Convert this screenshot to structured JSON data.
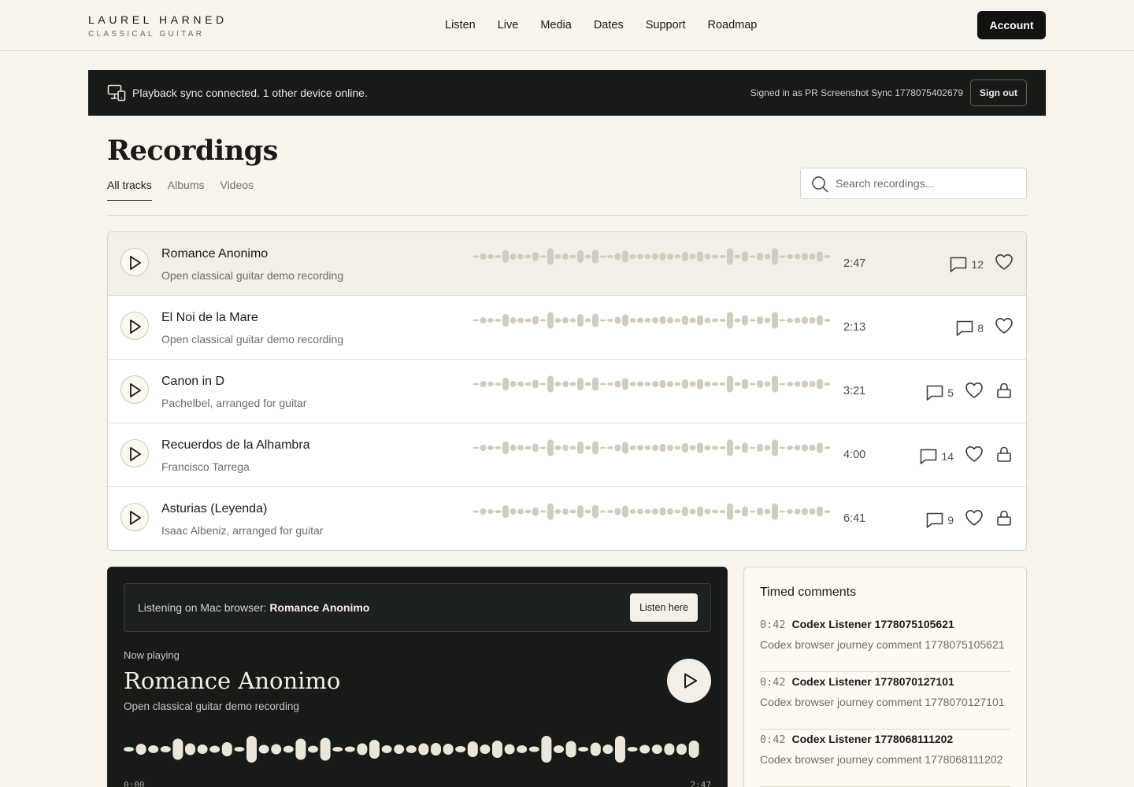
{
  "brand": {
    "name": "LAUREL HARNED",
    "subtitle": "CLASSICAL GUITAR"
  },
  "nav": [
    "Listen",
    "Live",
    "Media",
    "Dates",
    "Support",
    "Roadmap"
  ],
  "header": {
    "account_label": "Account"
  },
  "sync": {
    "status": "Playback sync connected. 1 other device online.",
    "signed_in": "Signed in as PR Screenshot Sync 1778075402679",
    "sign_out_label": "Sign out",
    "icon": "devices-icon"
  },
  "page": {
    "title": "Recordings",
    "tabs": [
      {
        "label": "All tracks",
        "active": true
      },
      {
        "label": "Albums",
        "active": false
      },
      {
        "label": "Videos",
        "active": false
      }
    ],
    "search": {
      "placeholder": "Search recordings...",
      "value": ""
    }
  },
  "tracks": [
    {
      "title": "Romance Anonimo",
      "subtitle": "Open classical guitar demo recording",
      "duration": "2:47",
      "comments": "12",
      "locked": false,
      "active": true
    },
    {
      "title": "El Noi de la Mare",
      "subtitle": "Open classical guitar demo recording",
      "duration": "2:13",
      "comments": "8",
      "locked": false,
      "active": false
    },
    {
      "title": "Canon in D",
      "subtitle": "Pachelbel, arranged for guitar",
      "duration": "3:21",
      "comments": "5",
      "locked": true,
      "active": false
    },
    {
      "title": "Recuerdos de la Alhambra",
      "subtitle": "Francisco Tarrega",
      "duration": "4:00",
      "comments": "14",
      "locked": true,
      "active": false
    },
    {
      "title": "Asturias (Leyenda)",
      "subtitle": "Isaac Albeniz, arranged for guitar",
      "duration": "6:41",
      "comments": "9",
      "locked": true,
      "active": false
    }
  ],
  "player": {
    "listening_prefix": "Listening on Mac browser:",
    "listening_track": "Romance Anonimo",
    "listen_here_label": "Listen here",
    "now_playing_label": "Now playing",
    "title": "Romance Anonimo",
    "subtitle": "Open classical guitar demo recording",
    "time_current": "0:00",
    "time_total": "2:47",
    "progress": 0
  },
  "comments": {
    "title": "Timed comments",
    "items": [
      {
        "time": "0:42",
        "author": "Codex Listener 1778075105621",
        "text": "Codex browser journey comment 1778075105621"
      },
      {
        "time": "0:42",
        "author": "Codex Listener 1778070127101",
        "text": "Codex browser journey comment 1778070127101"
      },
      {
        "time": "0:42",
        "author": "Codex Listener 1778068111202",
        "text": "Codex browser journey comment 1778068111202"
      }
    ]
  },
  "colors": {
    "background": "#f8f4ec",
    "dark": "#171a17",
    "wave_light": "#d2ccbd",
    "wave_player": "#ece6d8"
  }
}
